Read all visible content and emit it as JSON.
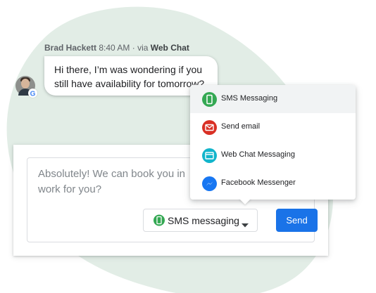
{
  "message": {
    "sender_name": "Brad Hackett",
    "time": "8:40 AM",
    "via_prefix": "· via",
    "channel": "Web Chat",
    "text": "Hi there, I’m was wondering if you still have availability for tomorrow?"
  },
  "composer": {
    "reply_text": "Absolutely! We can book you in work for you?",
    "selected_channel": "SMS messaging",
    "send_label": "Send"
  },
  "channel_menu": {
    "items": [
      {
        "label": "SMS Messaging",
        "icon": "sms-phone-icon",
        "color": "#34a853"
      },
      {
        "label": "Send email",
        "icon": "email-icon",
        "color": "#d93025"
      },
      {
        "label": "Web Chat Messaging",
        "icon": "web-chat-icon",
        "color": "#12b5cb"
      },
      {
        "label": "Facebook Messenger",
        "icon": "messenger-icon",
        "color": "#1877f2"
      }
    ]
  },
  "colors": {
    "blob": "#e2ede6",
    "send_button": "#1a73e8",
    "menu_highlight": "#f1f3f4"
  }
}
